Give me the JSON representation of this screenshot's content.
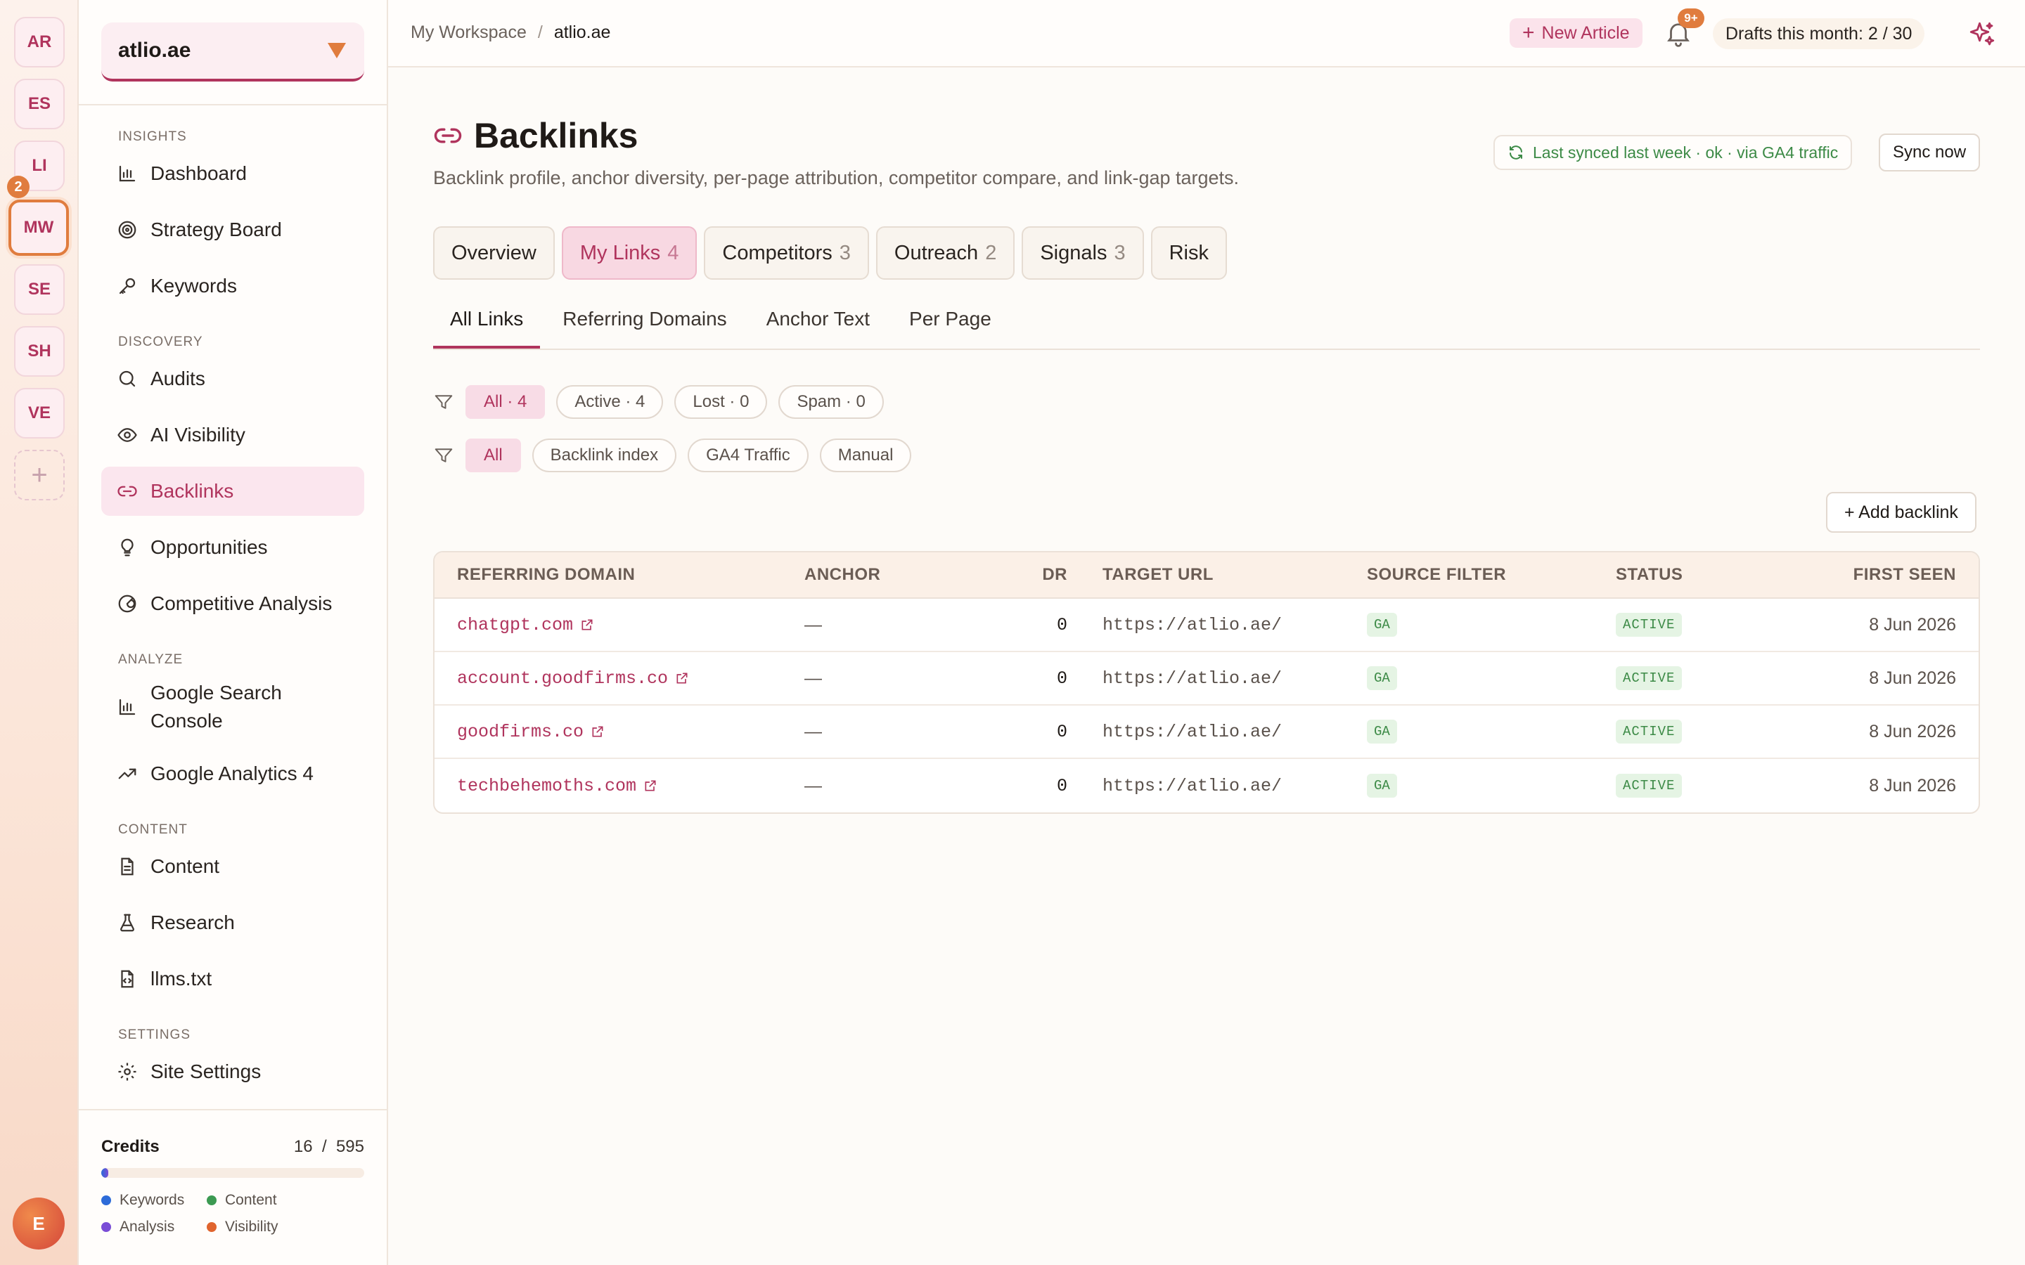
{
  "workspaces": [
    {
      "label": "AR"
    },
    {
      "label": "ES"
    },
    {
      "label": "LI"
    },
    {
      "label": "MW"
    },
    {
      "label": "SE"
    },
    {
      "label": "SH"
    },
    {
      "label": "VE"
    }
  ],
  "workspace_badge": "2",
  "workspace_add": "+",
  "user_avatar": "E",
  "site_selector": {
    "value": "atlio.ae"
  },
  "nav": {
    "insights": "INSIGHTS",
    "discovery": "DISCOVERY",
    "analyze": "ANALYZE",
    "content": "CONTENT",
    "settings": "SETTINGS",
    "items": {
      "dashboard": "Dashboard",
      "strategy": "Strategy Board",
      "keywords": "Keywords",
      "audits": "Audits",
      "ai_visibility": "AI Visibility",
      "backlinks": "Backlinks",
      "opportunities": "Opportunities",
      "competitive": "Competitive Analysis",
      "gsc": "Google Search Console",
      "ga4": "Google Analytics 4",
      "content": "Content",
      "research": "Research",
      "llms": "llms.txt",
      "site_settings": "Site Settings"
    }
  },
  "credits": {
    "label": "Credits",
    "used": "16",
    "sep": "/",
    "total": "595",
    "fraction": 0.027,
    "legend": {
      "keywords": "Keywords",
      "content": "Content",
      "analysis": "Analysis",
      "visibility": "Visibility"
    },
    "colors": {
      "keywords": "#2d6bd8",
      "content": "#3c9a52",
      "analysis": "#7a4dd6",
      "visibility": "#e0642e"
    }
  },
  "topbar": {
    "crumb_root": "My Workspace",
    "crumb_sep": "/",
    "crumb_current": "atlio.ae",
    "new_article_plus": "+",
    "new_article": "New Article",
    "notif_badge": "9+",
    "drafts": "Drafts this month: 2 / 30"
  },
  "page": {
    "title": "Backlinks",
    "subtitle": "Backlink profile, anchor diversity, per-page attribution, competitor compare, and link-gap targets.",
    "sync_status": "Last synced last week · ok · via GA4 traffic",
    "sync_now": "Sync now"
  },
  "tabs": [
    {
      "label": "Overview",
      "count": ""
    },
    {
      "label": "My Links",
      "count": "4"
    },
    {
      "label": "Competitors",
      "count": "3"
    },
    {
      "label": "Outreach",
      "count": "2"
    },
    {
      "label": "Signals",
      "count": "3"
    },
    {
      "label": "Risk",
      "count": ""
    }
  ],
  "subtabs": [
    "All Links",
    "Referring Domains",
    "Anchor Text",
    "Per Page"
  ],
  "status_filters": [
    "All · 4",
    "Active · 4",
    "Lost · 0",
    "Spam · 0"
  ],
  "source_filters": [
    "All",
    "Backlink index",
    "GA4 Traffic",
    "Manual"
  ],
  "add_backlink": "+ Add backlink",
  "table": {
    "headers": {
      "domain": "REFERRING DOMAIN",
      "anchor": "ANCHOR",
      "dr": "DR",
      "url": "TARGET URL",
      "source": "SOURCE FILTER",
      "status": "STATUS",
      "first_seen": "FIRST SEEN"
    },
    "rows": [
      {
        "domain": "chatgpt.com",
        "anchor": "—",
        "dr": "0",
        "url": "https://atlio.ae/",
        "source": "GA",
        "status": "ACTIVE",
        "first_seen": "8 Jun 2026"
      },
      {
        "domain": "account.goodfirms.co",
        "anchor": "—",
        "dr": "0",
        "url": "https://atlio.ae/",
        "source": "GA",
        "status": "ACTIVE",
        "first_seen": "8 Jun 2026"
      },
      {
        "domain": "goodfirms.co",
        "anchor": "—",
        "dr": "0",
        "url": "https://atlio.ae/",
        "source": "GA",
        "status": "ACTIVE",
        "first_seen": "8 Jun 2026"
      },
      {
        "domain": "techbehemoths.com",
        "anchor": "—",
        "dr": "0",
        "url": "https://atlio.ae/",
        "source": "GA",
        "status": "ACTIVE",
        "first_seen": "8 Jun 2026"
      }
    ]
  }
}
